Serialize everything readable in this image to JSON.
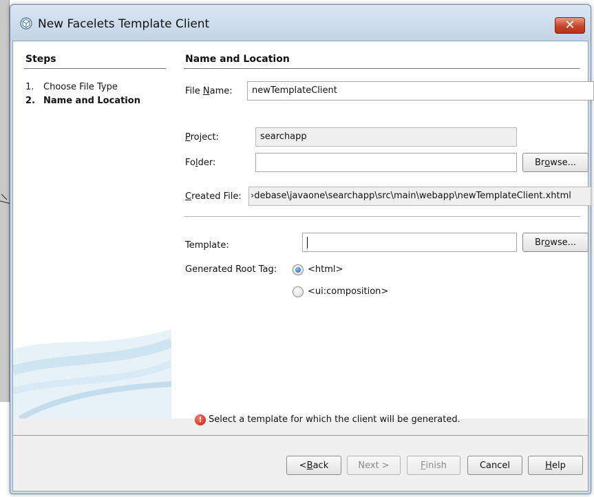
{
  "dialog": {
    "title": "New Facelets Template Client",
    "close_glyph": "✕"
  },
  "steps": {
    "title": "Steps",
    "items": [
      {
        "num": "1.",
        "label": "Choose File Type",
        "active": false
      },
      {
        "num": "2.",
        "label": "Name and Location",
        "active": true
      }
    ]
  },
  "form": {
    "section_title": "Name and Location",
    "file_name": {
      "label_pre": "File ",
      "label_mn": "N",
      "label_post": "ame:",
      "value": "newTemplateClient"
    },
    "project": {
      "label_pre": "",
      "label_mn": "P",
      "label_post": "roject:",
      "value": "searchapp"
    },
    "folder": {
      "label_pre": "Fo",
      "label_mn": "l",
      "label_post": "der:",
      "value": ""
    },
    "folder_browse": {
      "pre": "Br",
      "mn": "o",
      "post": "wse..."
    },
    "created_file": {
      "label_pre": "",
      "label_mn": "C",
      "label_post": "reated File:",
      "value": "›debase\\javaone\\searchapp\\src\\main\\webapp\\newTemplateClient.xhtml"
    },
    "template": {
      "label": "Template:",
      "value": ""
    },
    "template_browse": {
      "pre": "Br",
      "mn": "o",
      "post": "wse..."
    },
    "root_tag": {
      "label": "Generated Root Tag:",
      "options": [
        {
          "label": "<html>",
          "checked": true
        },
        {
          "label": "<ui:composition>",
          "checked": false
        }
      ]
    },
    "error_message": "Select a template for which the client will be generated."
  },
  "buttons": {
    "back": {
      "pre": "< ",
      "mn": "B",
      "post": "ack"
    },
    "next": {
      "label": "Next >"
    },
    "finish": {
      "pre": "",
      "mn": "F",
      "post": "inish"
    },
    "cancel": {
      "label": "Cancel"
    },
    "help": {
      "pre": "",
      "mn": "H",
      "post": "elp"
    }
  },
  "colors": {
    "accent": "#1d5fb0",
    "close_red": "#c6452b",
    "error_red": "#c8170a"
  },
  "icons": {
    "title": "netbeans-cube-icon",
    "close": "close-icon",
    "error": "error-icon"
  }
}
